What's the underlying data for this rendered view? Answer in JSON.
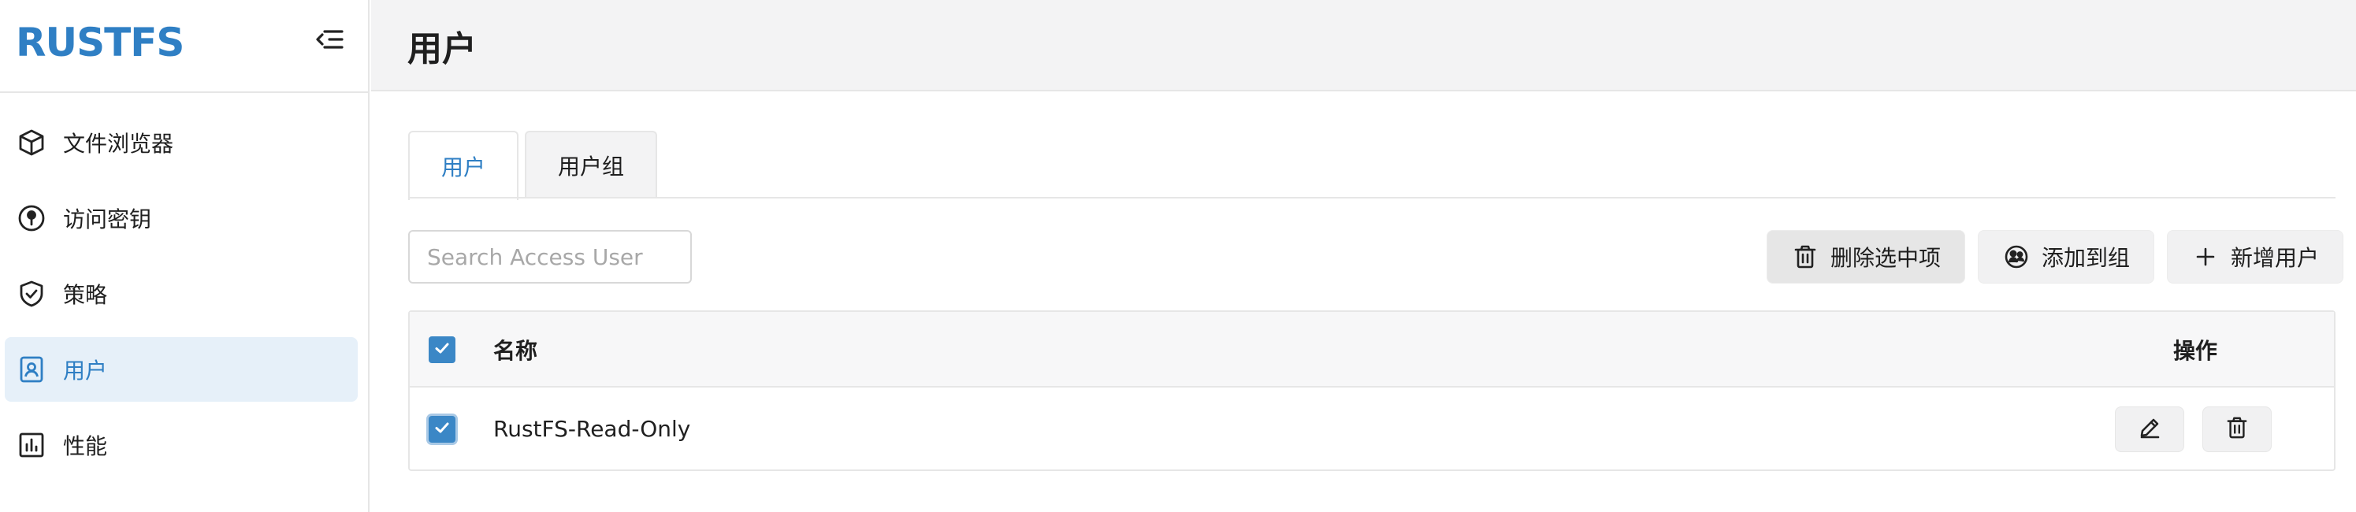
{
  "brand": {
    "name": "RUSTFS"
  },
  "sidebar": {
    "items": [
      {
        "label": "文件浏览器",
        "icon": "cube-icon",
        "active": false
      },
      {
        "label": "访问密钥",
        "icon": "key-circle-icon",
        "active": false
      },
      {
        "label": "策略",
        "icon": "shield-check-icon",
        "active": false
      },
      {
        "label": "用户",
        "icon": "user-badge-icon",
        "active": true
      },
      {
        "label": "性能",
        "icon": "bar-chart-icon",
        "active": false
      }
    ]
  },
  "header": {
    "title": "用户"
  },
  "tabs": [
    {
      "label": "用户",
      "active": true
    },
    {
      "label": "用户组",
      "active": false
    }
  ],
  "search": {
    "placeholder": "Search Access User",
    "value": ""
  },
  "toolbar": {
    "delete_label": "删除选中项",
    "add_to_group_label": "添加到组",
    "new_user_label": "新增用户"
  },
  "table": {
    "columns": {
      "name": "名称",
      "ops": "操作"
    },
    "rows": [
      {
        "name": "RustFS-Read-Only",
        "checked": true
      }
    ],
    "header_checked": true
  },
  "colors": {
    "accent": "#2f7fc4",
    "checkbox": "#3b87c6",
    "active_bg": "#e6f0f9"
  }
}
